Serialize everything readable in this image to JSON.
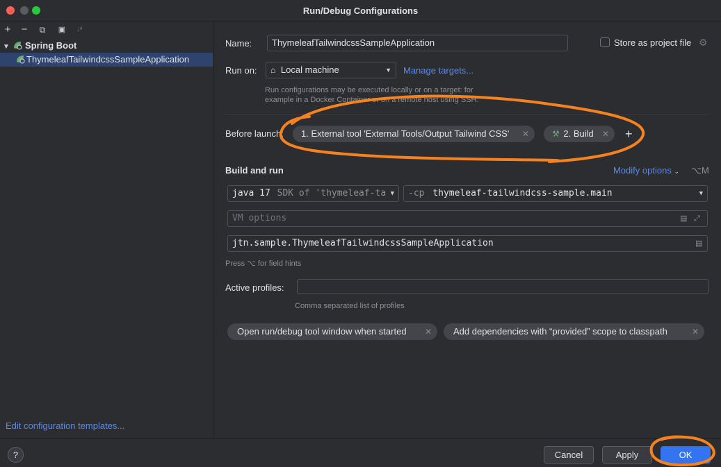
{
  "window": {
    "title": "Run/Debug Configurations"
  },
  "toolbar": {
    "add": "+",
    "remove": "−",
    "copy": "⧉",
    "folder": "▣",
    "sort": "↓ᵃ"
  },
  "tree": {
    "group": "Spring Boot",
    "item": "ThymeleafTailwindcssSampleApplication"
  },
  "left": {
    "edit_templates": "Edit configuration templates..."
  },
  "form": {
    "name_label": "Name:",
    "name_value": "ThymeleafTailwindcssSampleApplication",
    "store_label": "Store as project file",
    "run_on_label": "Run on:",
    "run_on_value": "Local machine",
    "manage_targets": "Manage targets...",
    "run_on_hint_1": "Run configurations may be executed locally or on a target: for",
    "run_on_hint_2": "example in a Docker Container or on a remote host using SSH.",
    "before_launch_label": "Before launch:",
    "before_launch_tasks": [
      "1. External tool 'External Tools/Output Tailwind CSS'",
      "2. Build"
    ],
    "build_run_title": "Build and run",
    "modify_options": "Modify options",
    "modify_shortcut": "⌥M",
    "jdk_main": "java 17",
    "jdk_sub": "SDK of 'thymeleaf-ta",
    "cp_prefix": "-cp",
    "cp_value": "thymeleaf-tailwindcss-sample.main",
    "vm_placeholder": "VM options",
    "main_class": "jtn.sample.ThymeleafTailwindcssSampleApplication",
    "field_hint": "Press ⌥ for field hints",
    "profiles_label": "Active profiles:",
    "profiles_hint": "Comma separated list of profiles",
    "option_chips": [
      "Open run/debug tool window when started",
      "Add dependencies with “provided” scope to classpath"
    ]
  },
  "buttons": {
    "help": "?",
    "cancel": "Cancel",
    "apply": "Apply",
    "ok": "OK"
  },
  "colors": {
    "accent": "#3574f0",
    "link": "#548af7",
    "annotation": "#f5821f",
    "selection": "#2e436e"
  }
}
